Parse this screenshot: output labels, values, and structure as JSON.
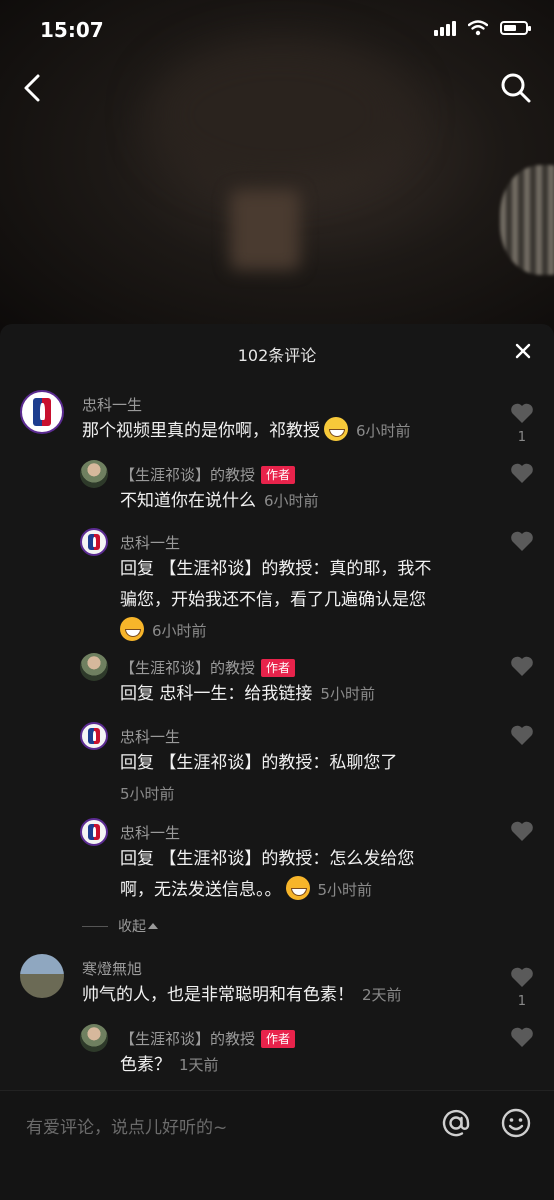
{
  "status_bar": {
    "time": "15:07"
  },
  "sheet": {
    "title": "102条评论"
  },
  "comments": [
    {
      "name": "忠科一生",
      "text": "那个视频里真的是你啊，祁教授",
      "time": "6小时前",
      "likes": "1",
      "emoji": "grinning-face"
    },
    {
      "name": "【生涯祁谈】的教授",
      "tag": "作者",
      "text": "不知道你在说什么",
      "time": "6小时前"
    },
    {
      "name": "忠科一生",
      "text_line1": "回复 【生涯祁谈】的教授：真的耶，我不",
      "text_line2": "骗您，开始我还不信，看了几遍确认是您",
      "time": "6小时前",
      "emoji": "rofl-face"
    },
    {
      "name": "【生涯祁谈】的教授",
      "tag": "作者",
      "text": "回复 忠科一生：给我链接",
      "time": "5小时前"
    },
    {
      "name": "忠科一生",
      "text": "回复 【生涯祁谈】的教授：私聊您了",
      "time": "5小时前"
    },
    {
      "name": "忠科一生",
      "text_line1": "回复 【生涯祁谈】的教授：怎么发给您",
      "text_line2": "啊，无法发送信息。。",
      "time": "5小时前",
      "emoji": "rofl-face"
    },
    {
      "name": "寒燈無旭",
      "text": "帅气的人，也是非常聪明和有色素！",
      "time": "2天前",
      "likes": "1"
    },
    {
      "name": "【生涯祁谈】的教授",
      "tag": "作者",
      "text": "色素？",
      "time": "1天前"
    }
  ],
  "collapse_label": "收起",
  "input": {
    "placeholder": "有爱评论，说点儿好听的~"
  },
  "colors": {
    "author_tag": "#e8234b",
    "sheet_bg": "#161616"
  }
}
